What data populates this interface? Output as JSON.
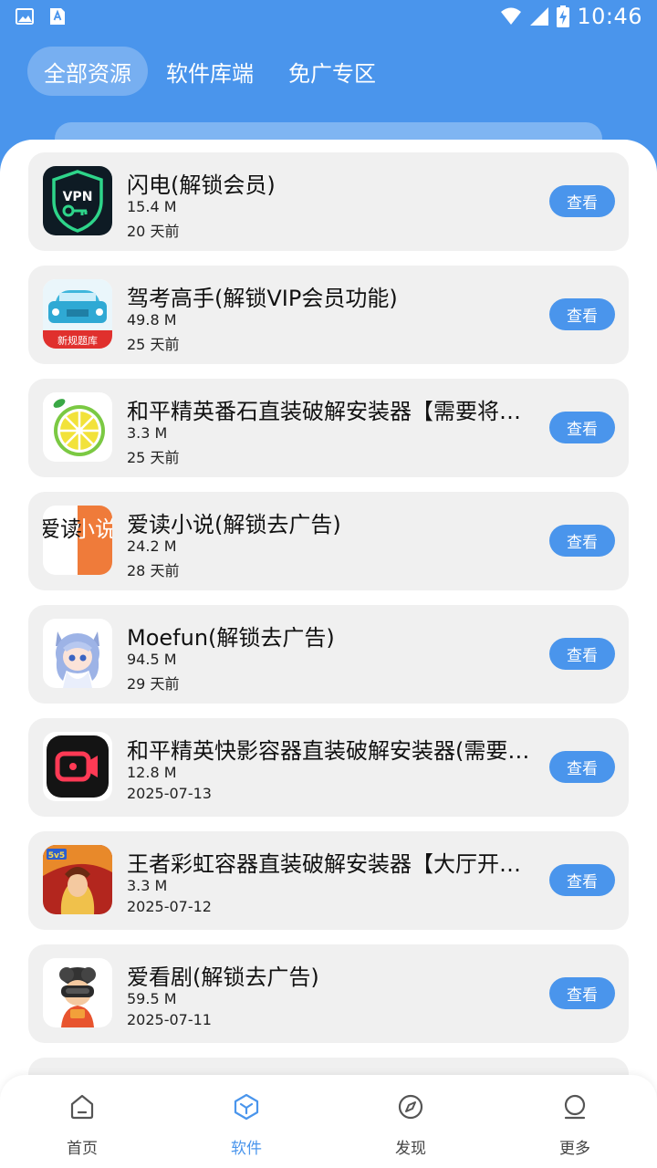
{
  "status_bar": {
    "time": "10:46"
  },
  "tabs": [
    {
      "label": "全部资源",
      "active": true
    },
    {
      "label": "软件库端",
      "active": false
    },
    {
      "label": "免广专区",
      "active": false
    }
  ],
  "items": [
    {
      "title": "闪电(解锁会员)",
      "size": "15.4 M",
      "date": "20 天前",
      "button": "查看",
      "icon": "vpn-icon",
      "icon_text": "VPN"
    },
    {
      "title": "驾考高手(解锁VIP会员功能)",
      "size": "49.8 M",
      "date": "25 天前",
      "button": "查看",
      "icon": "car-icon",
      "icon_text": "新规题库"
    },
    {
      "title": "和平精英番石直装破解安装器【需要将网络改成VPN】",
      "size": "3.3 M",
      "date": "25 天前",
      "button": "查看",
      "icon": "lemon-icon"
    },
    {
      "title": "爱读小说(解锁去广告)",
      "size": "24.2 M",
      "date": "28 天前",
      "button": "查看",
      "icon": "book-icon",
      "icon_text_left": "爱读",
      "icon_text_right": "小说"
    },
    {
      "title": "Moefun(解锁去广告)",
      "size": "94.5 M",
      "date": "29 天前",
      "button": "查看",
      "icon": "anime-girl-icon"
    },
    {
      "title": "和平精英快影容器直装破解安装器(需要将网络改成VPN)",
      "size": "12.8 M",
      "date": "2025-07-13",
      "button": "查看",
      "icon": "video-camera-icon"
    },
    {
      "title": "王者彩虹容器直装破解安装器【大厅开功能】",
      "size": "3.3 M",
      "date": "2025-07-12",
      "button": "查看",
      "icon": "game-hero-icon",
      "icon_text": "5v5"
    },
    {
      "title": "爱看剧(解锁去广告)",
      "size": "59.5 M",
      "date": "2025-07-11",
      "button": "查看",
      "icon": "vr-mascot-icon"
    }
  ],
  "nav": [
    {
      "label": "首页",
      "icon": "home-icon",
      "active": false
    },
    {
      "label": "软件",
      "icon": "cube-icon",
      "active": true
    },
    {
      "label": "发现",
      "icon": "compass-icon",
      "active": false
    },
    {
      "label": "更多",
      "icon": "user-icon",
      "active": false
    }
  ],
  "colors": {
    "primary": "#4a95ec",
    "card_bg": "#f0f0f0"
  }
}
